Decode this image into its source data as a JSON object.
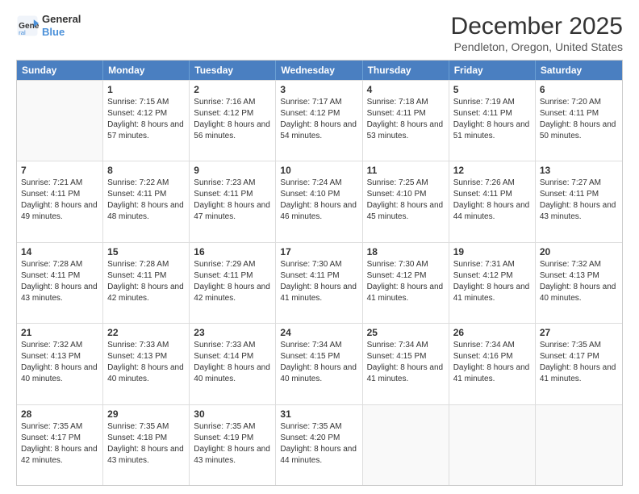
{
  "logo": {
    "line1": "General",
    "line2": "Blue"
  },
  "title": "December 2025",
  "subtitle": "Pendleton, Oregon, United States",
  "header_days": [
    "Sunday",
    "Monday",
    "Tuesday",
    "Wednesday",
    "Thursday",
    "Friday",
    "Saturday"
  ],
  "weeks": [
    [
      {
        "day": "",
        "empty": true
      },
      {
        "day": "1",
        "sunrise": "Sunrise: 7:15 AM",
        "sunset": "Sunset: 4:12 PM",
        "daylight": "Daylight: 8 hours and 57 minutes."
      },
      {
        "day": "2",
        "sunrise": "Sunrise: 7:16 AM",
        "sunset": "Sunset: 4:12 PM",
        "daylight": "Daylight: 8 hours and 56 minutes."
      },
      {
        "day": "3",
        "sunrise": "Sunrise: 7:17 AM",
        "sunset": "Sunset: 4:12 PM",
        "daylight": "Daylight: 8 hours and 54 minutes."
      },
      {
        "day": "4",
        "sunrise": "Sunrise: 7:18 AM",
        "sunset": "Sunset: 4:11 PM",
        "daylight": "Daylight: 8 hours and 53 minutes."
      },
      {
        "day": "5",
        "sunrise": "Sunrise: 7:19 AM",
        "sunset": "Sunset: 4:11 PM",
        "daylight": "Daylight: 8 hours and 51 minutes."
      },
      {
        "day": "6",
        "sunrise": "Sunrise: 7:20 AM",
        "sunset": "Sunset: 4:11 PM",
        "daylight": "Daylight: 8 hours and 50 minutes."
      }
    ],
    [
      {
        "day": "7",
        "sunrise": "Sunrise: 7:21 AM",
        "sunset": "Sunset: 4:11 PM",
        "daylight": "Daylight: 8 hours and 49 minutes."
      },
      {
        "day": "8",
        "sunrise": "Sunrise: 7:22 AM",
        "sunset": "Sunset: 4:11 PM",
        "daylight": "Daylight: 8 hours and 48 minutes."
      },
      {
        "day": "9",
        "sunrise": "Sunrise: 7:23 AM",
        "sunset": "Sunset: 4:11 PM",
        "daylight": "Daylight: 8 hours and 47 minutes."
      },
      {
        "day": "10",
        "sunrise": "Sunrise: 7:24 AM",
        "sunset": "Sunset: 4:10 PM",
        "daylight": "Daylight: 8 hours and 46 minutes."
      },
      {
        "day": "11",
        "sunrise": "Sunrise: 7:25 AM",
        "sunset": "Sunset: 4:10 PM",
        "daylight": "Daylight: 8 hours and 45 minutes."
      },
      {
        "day": "12",
        "sunrise": "Sunrise: 7:26 AM",
        "sunset": "Sunset: 4:11 PM",
        "daylight": "Daylight: 8 hours and 44 minutes."
      },
      {
        "day": "13",
        "sunrise": "Sunrise: 7:27 AM",
        "sunset": "Sunset: 4:11 PM",
        "daylight": "Daylight: 8 hours and 43 minutes."
      }
    ],
    [
      {
        "day": "14",
        "sunrise": "Sunrise: 7:28 AM",
        "sunset": "Sunset: 4:11 PM",
        "daylight": "Daylight: 8 hours and 43 minutes."
      },
      {
        "day": "15",
        "sunrise": "Sunrise: 7:28 AM",
        "sunset": "Sunset: 4:11 PM",
        "daylight": "Daylight: 8 hours and 42 minutes."
      },
      {
        "day": "16",
        "sunrise": "Sunrise: 7:29 AM",
        "sunset": "Sunset: 4:11 PM",
        "daylight": "Daylight: 8 hours and 42 minutes."
      },
      {
        "day": "17",
        "sunrise": "Sunrise: 7:30 AM",
        "sunset": "Sunset: 4:11 PM",
        "daylight": "Daylight: 8 hours and 41 minutes."
      },
      {
        "day": "18",
        "sunrise": "Sunrise: 7:30 AM",
        "sunset": "Sunset: 4:12 PM",
        "daylight": "Daylight: 8 hours and 41 minutes."
      },
      {
        "day": "19",
        "sunrise": "Sunrise: 7:31 AM",
        "sunset": "Sunset: 4:12 PM",
        "daylight": "Daylight: 8 hours and 41 minutes."
      },
      {
        "day": "20",
        "sunrise": "Sunrise: 7:32 AM",
        "sunset": "Sunset: 4:13 PM",
        "daylight": "Daylight: 8 hours and 40 minutes."
      }
    ],
    [
      {
        "day": "21",
        "sunrise": "Sunrise: 7:32 AM",
        "sunset": "Sunset: 4:13 PM",
        "daylight": "Daylight: 8 hours and 40 minutes."
      },
      {
        "day": "22",
        "sunrise": "Sunrise: 7:33 AM",
        "sunset": "Sunset: 4:13 PM",
        "daylight": "Daylight: 8 hours and 40 minutes."
      },
      {
        "day": "23",
        "sunrise": "Sunrise: 7:33 AM",
        "sunset": "Sunset: 4:14 PM",
        "daylight": "Daylight: 8 hours and 40 minutes."
      },
      {
        "day": "24",
        "sunrise": "Sunrise: 7:34 AM",
        "sunset": "Sunset: 4:15 PM",
        "daylight": "Daylight: 8 hours and 40 minutes."
      },
      {
        "day": "25",
        "sunrise": "Sunrise: 7:34 AM",
        "sunset": "Sunset: 4:15 PM",
        "daylight": "Daylight: 8 hours and 41 minutes."
      },
      {
        "day": "26",
        "sunrise": "Sunrise: 7:34 AM",
        "sunset": "Sunset: 4:16 PM",
        "daylight": "Daylight: 8 hours and 41 minutes."
      },
      {
        "day": "27",
        "sunrise": "Sunrise: 7:35 AM",
        "sunset": "Sunset: 4:17 PM",
        "daylight": "Daylight: 8 hours and 41 minutes."
      }
    ],
    [
      {
        "day": "28",
        "sunrise": "Sunrise: 7:35 AM",
        "sunset": "Sunset: 4:17 PM",
        "daylight": "Daylight: 8 hours and 42 minutes."
      },
      {
        "day": "29",
        "sunrise": "Sunrise: 7:35 AM",
        "sunset": "Sunset: 4:18 PM",
        "daylight": "Daylight: 8 hours and 43 minutes."
      },
      {
        "day": "30",
        "sunrise": "Sunrise: 7:35 AM",
        "sunset": "Sunset: 4:19 PM",
        "daylight": "Daylight: 8 hours and 43 minutes."
      },
      {
        "day": "31",
        "sunrise": "Sunrise: 7:35 AM",
        "sunset": "Sunset: 4:20 PM",
        "daylight": "Daylight: 8 hours and 44 minutes."
      },
      {
        "day": "",
        "empty": true
      },
      {
        "day": "",
        "empty": true
      },
      {
        "day": "",
        "empty": true
      }
    ]
  ]
}
